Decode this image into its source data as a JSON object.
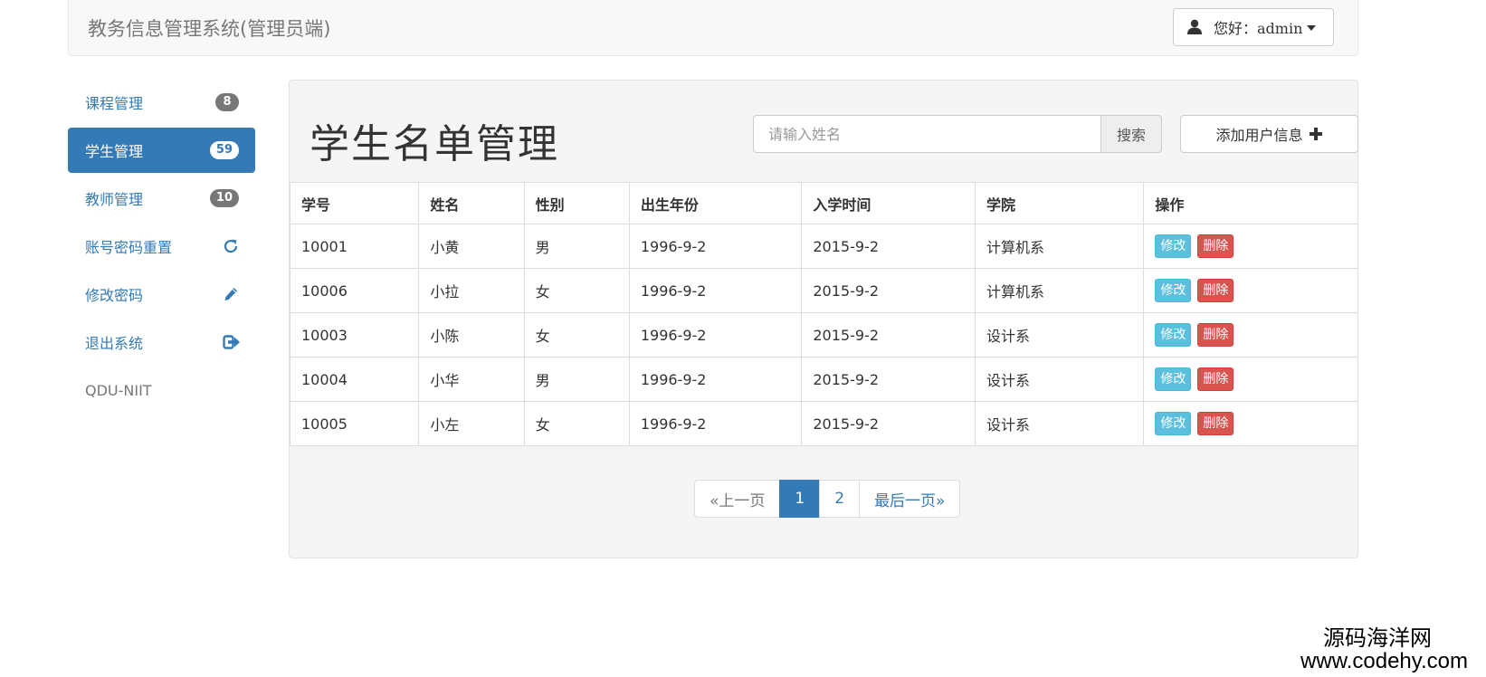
{
  "navbar": {
    "brand": "教务信息管理系统(管理员端)",
    "user_greeting": "您好：admin"
  },
  "sidebar": {
    "items": [
      {
        "label": "课程管理",
        "badge": "8",
        "active": false
      },
      {
        "label": "学生管理",
        "badge": "59",
        "active": true
      },
      {
        "label": "教师管理",
        "badge": "10",
        "active": false
      },
      {
        "label": "账号密码重置",
        "icon": "refresh-icon"
      },
      {
        "label": "修改密码",
        "icon": "pencil-icon"
      },
      {
        "label": "退出系统",
        "icon": "logout-icon"
      }
    ],
    "footer_label": "QDU-NIIT"
  },
  "main": {
    "title": "学生名单管理",
    "search": {
      "placeholder": "请输入姓名",
      "button_label": "搜索"
    },
    "add_button_label": "添加用户信息",
    "table": {
      "headers": [
        "学号",
        "姓名",
        "性别",
        "出生年份",
        "入学时间",
        "学院",
        "操作"
      ],
      "rows": [
        {
          "id": "10001",
          "name": "小黄",
          "gender": "男",
          "birth": "1996-9-2",
          "enroll": "2015-9-2",
          "college": "计算机系"
        },
        {
          "id": "10006",
          "name": "小拉",
          "gender": "女",
          "birth": "1996-9-2",
          "enroll": "2015-9-2",
          "college": "计算机系"
        },
        {
          "id": "10003",
          "name": "小陈",
          "gender": "女",
          "birth": "1996-9-2",
          "enroll": "2015-9-2",
          "college": "设计系"
        },
        {
          "id": "10004",
          "name": "小华",
          "gender": "男",
          "birth": "1996-9-2",
          "enroll": "2015-9-2",
          "college": "设计系"
        },
        {
          "id": "10005",
          "name": "小左",
          "gender": "女",
          "birth": "1996-9-2",
          "enroll": "2015-9-2",
          "college": "设计系"
        }
      ],
      "edit_label": "修改",
      "delete_label": "删除"
    },
    "pagination": {
      "prev_label": "«上一页",
      "pages": [
        "1",
        "2"
      ],
      "active_page": "1",
      "last_label": "最后一页»"
    }
  },
  "watermark": {
    "cn": "源码海洋网",
    "url": "www.codehy.com"
  },
  "colors": {
    "primary": "#337ab7",
    "info": "#5bc0de",
    "danger": "#d9534f",
    "panel_bg": "#f5f5f5"
  }
}
